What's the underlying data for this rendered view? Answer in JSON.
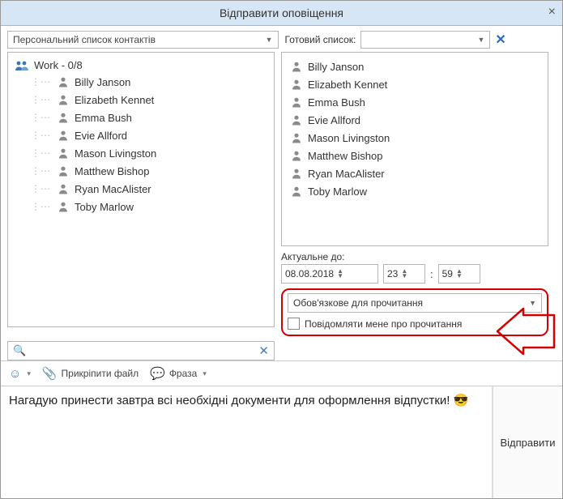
{
  "title": "Відправити оповіщення",
  "left_combo": "Персональний список контактів",
  "ready_label": "Готовий список:",
  "ready_value": "",
  "group": {
    "name": "Work - 0/8"
  },
  "left_people": [
    "Billy Janson",
    "Elizabeth Kennet",
    "Emma Bush",
    "Evie Allford",
    "Mason Livingston",
    "Matthew Bishop",
    "Ryan MacAlister",
    "Toby Marlow"
  ],
  "right_people": [
    "Billy Janson",
    "Elizabeth Kennet",
    "Emma Bush",
    "Evie Allford",
    "Mason Livingston",
    "Matthew Bishop",
    "Ryan MacAlister",
    "Toby Marlow"
  ],
  "actual_label": "Актуальне до:",
  "date": "08.08.2018",
  "hour": "23",
  "minute": "59",
  "read_required": "Обов'язкове для прочитання",
  "notify_label": "Повідомляти мене про прочитання",
  "attach_label": "Прикріпити файл",
  "phrase_label": "Фраза",
  "message": "Нагадую принести завтра всі необхідні документи для оформлення відпустки! 😎",
  "send_label": "Відправити",
  "search_placeholder": ""
}
